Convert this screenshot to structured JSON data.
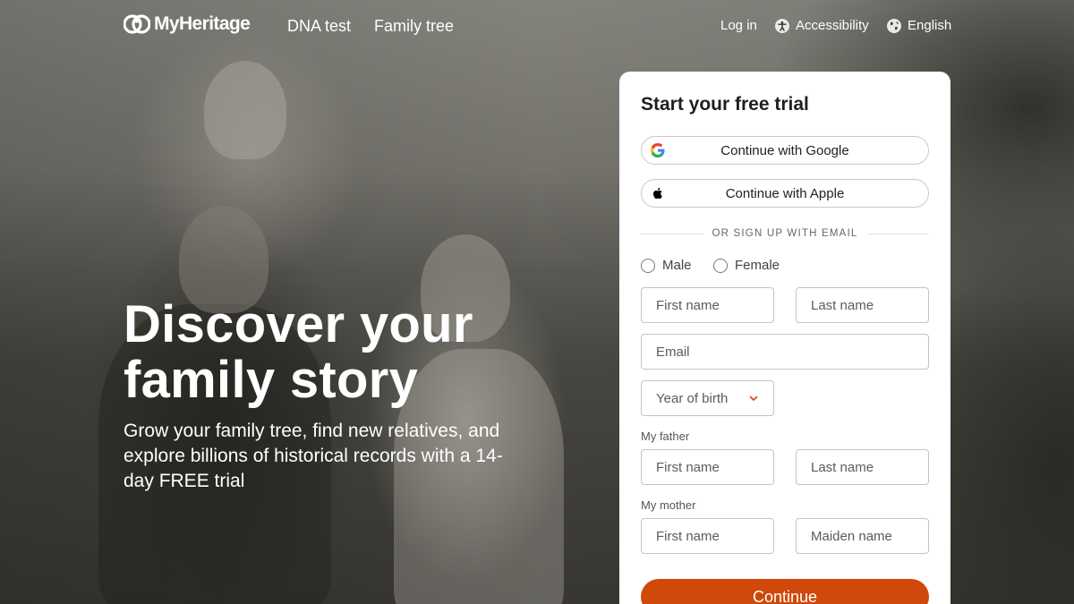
{
  "header": {
    "logo_text": "MyHeritage",
    "nav": [
      "DNA test",
      "Family tree"
    ],
    "login": "Log in",
    "accessibility": "Accessibility",
    "language": "English"
  },
  "hero": {
    "title_line1": "Discover your",
    "title_line2": "family story",
    "subtitle": "Grow your family tree, find new relatives, and explore billions of historical records with a 14-day FREE trial"
  },
  "signup": {
    "title": "Start your free trial",
    "google_label": "Continue with Google",
    "apple_label": "Continue with Apple",
    "divider": "OR SIGN UP WITH EMAIL",
    "gender_options": [
      "Male",
      "Female"
    ],
    "first_name_placeholder": "First name",
    "last_name_placeholder": "Last name",
    "email_placeholder": "Email",
    "year_of_birth": "Year of birth",
    "father_label": "My father",
    "father_first_placeholder": "First name",
    "father_last_placeholder": "Last name",
    "mother_label": "My mother",
    "mother_first_placeholder": "First name",
    "mother_maiden_placeholder": "Maiden name",
    "continue_label": "Continue"
  },
  "colors": {
    "accent": "#d0480a",
    "card_bg": "#ffffff"
  }
}
